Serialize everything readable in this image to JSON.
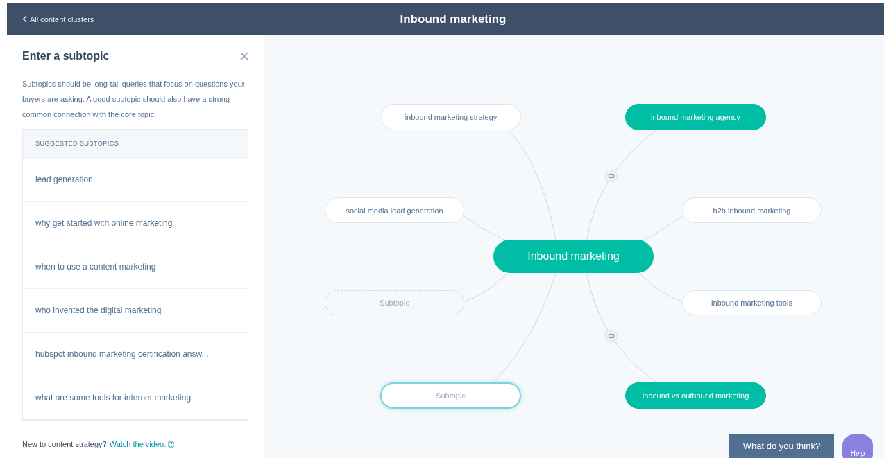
{
  "header": {
    "back_link": "All content clusters",
    "title": "Inbound marketing"
  },
  "panel": {
    "title": "Enter a subtopic",
    "description": "Subtopics should be long-tail queries that focus on questions your buyers are asking. A good subtopic should also have a strong common connection with the core topic.",
    "list_heading": "SUGGESTED SUBTOPICS",
    "suggestions": [
      "lead generation",
      "why get started with online marketing",
      "when to use a content marketing",
      "who invented the digital marketing",
      "hubspot inbound marketing certification answ...",
      "what are some tools for internet marketing"
    ],
    "footer_text": "New to content strategy?",
    "footer_link": "Watch the video."
  },
  "map": {
    "center": "Inbound marketing",
    "nodes": [
      {
        "label": "inbound marketing strategy",
        "kind": "suggestion"
      },
      {
        "label": "inbound marketing agency",
        "kind": "chosen"
      },
      {
        "label": "social media lead generation",
        "kind": "suggestion"
      },
      {
        "label": "b2b inbound marketing",
        "kind": "suggestion"
      },
      {
        "label": "Subtopic",
        "kind": "empty"
      },
      {
        "label": "inbound marketing tools",
        "kind": "suggestion"
      },
      {
        "label": "Subtopic",
        "kind": "editing"
      },
      {
        "label": "inbound vs outbound marketing",
        "kind": "chosen"
      }
    ]
  },
  "feedback_button": "What do you think?",
  "help_button": "Help"
}
